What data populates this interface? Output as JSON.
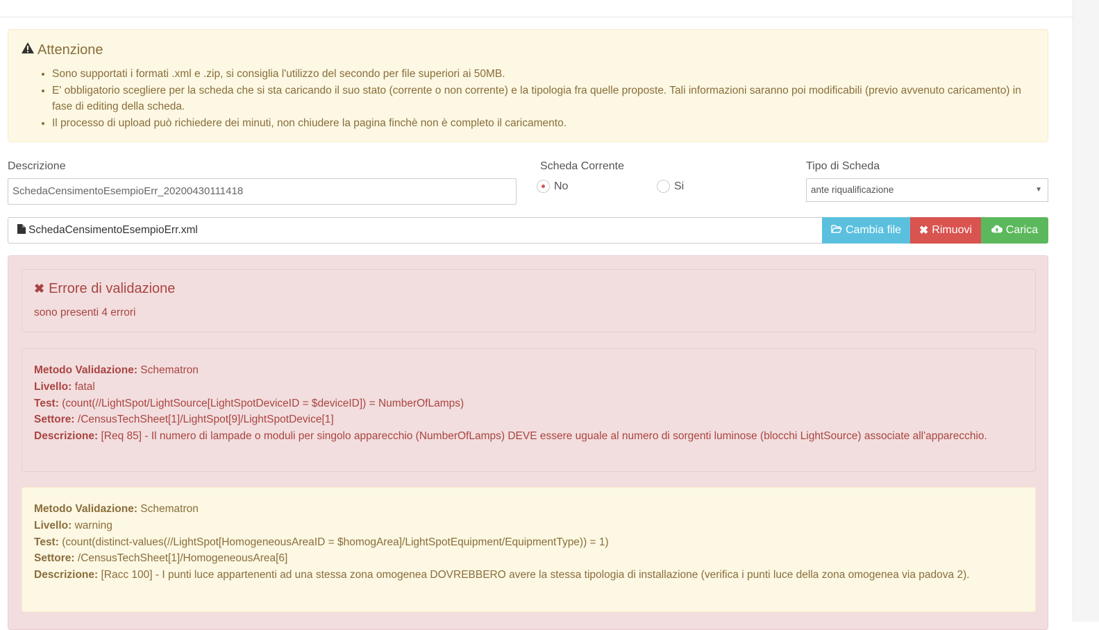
{
  "alert": {
    "title": "Attenzione",
    "items": [
      "Sono supportati i formati .xml e .zip, si consiglia l'utilizzo del secondo per file superiori ai 50MB.",
      "E' obbligatorio scegliere per la scheda che si sta caricando il suo stato (corrente o non corrente) e la tipologia fra quelle proposte. Tali informazioni saranno poi modificabili (previo avvenuto caricamento) in fase di editing della scheda.",
      "Il processo di upload può richiedere dei minuti, non chiudere la pagina finchè non è completo il caricamento."
    ]
  },
  "form": {
    "descrizione_label": "Descrizione",
    "descrizione_value": "SchedaCensimentoEsempioErr_20200430111418",
    "scheda_corrente_label": "Scheda Corrente",
    "radio_no": "No",
    "radio_si": "Si",
    "tipo_label": "Tipo di Scheda",
    "tipo_value": "ante riqualificazione"
  },
  "file": {
    "name": "SchedaCensimentoEsempioErr.xml",
    "change_label": "Cambia file",
    "remove_label": "Rimuovi",
    "upload_label": "Carica"
  },
  "validation": {
    "title": "Errore di validazione",
    "subtitle": "sono presenti 4 errori",
    "labels": {
      "metodo": "Metodo Validazione:",
      "livello": "Livello:",
      "test": "Test:",
      "settore": "Settore:",
      "descrizione": "Descrizione:"
    },
    "errors": [
      {
        "metodo": "Schematron",
        "livello": "fatal",
        "test": "(count(//LightSpot/LightSource[LightSpotDeviceID = $deviceID]) = NumberOfLamps)",
        "settore": "/CensusTechSheet[1]/LightSpot[9]/LightSpotDevice[1]",
        "descrizione": "[Req 85] - Il numero di lampade o moduli per singolo apparecchio (NumberOfLamps) DEVE essere uguale al numero di sorgenti luminose (blocchi LightSource) associate all'apparecchio."
      },
      {
        "metodo": "Schematron",
        "livello": "warning",
        "test": "(count(distinct-values(//LightSpot[HomogeneousAreaID = $homogArea]/LightSpotEquipment/EquipmentType)) = 1)",
        "settore": "/CensusTechSheet[1]/HomogeneousArea[6]",
        "descrizione": "[Racc 100] - I punti luce appartenenti ad una stessa zona omogenea DOVREBBERO avere la stessa tipologia di installazione (verifica i punti luce della zona omogenea via padova 2)."
      }
    ]
  }
}
